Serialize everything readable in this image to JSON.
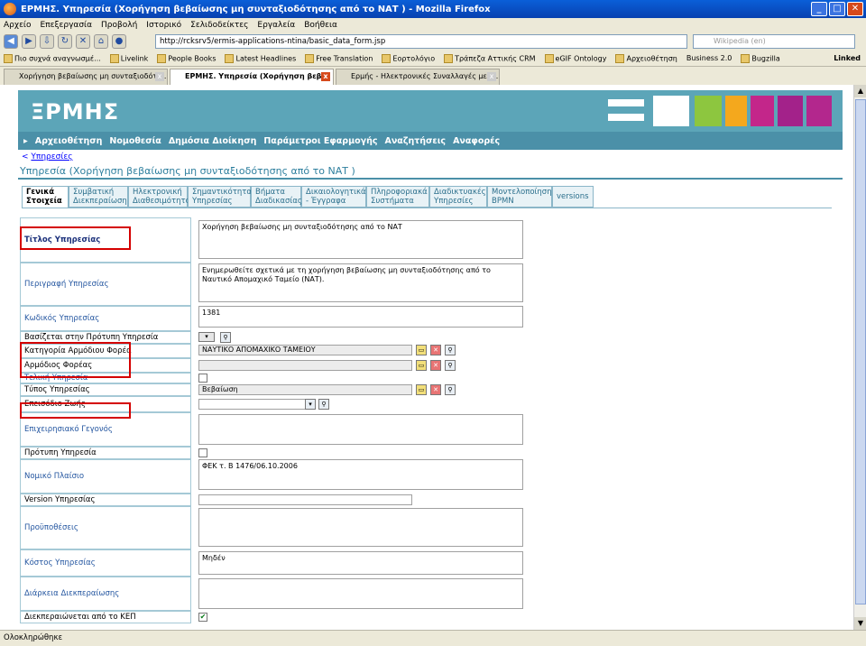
{
  "browser": {
    "title": "ΕΡΜΗΣ. Υπηρεσία (Χορήγηση βεβαίωσης μη συνταξιοδότησης από το ΝΑΤ ) - Mozilla Firefox",
    "menu": [
      "Αρχείο",
      "Επεξεργασία",
      "Προβολή",
      "Ιστορικό",
      "Σελιδοδείκτες",
      "Εργαλεία",
      "Βοήθεια"
    ],
    "url": "http://rcksrv5/ermis-applications-ntina/basic_data_form.jsp",
    "search_placeholder": "Wikipedia (en)",
    "bookmarks": [
      "Πιο συχνά αναγνωσμέ...",
      "Livelink",
      "People Books",
      "Latest Headlines",
      "Free Translation",
      "Εορτολόγιο",
      "Τράπεζα Αττικής CRM",
      "eGIF Ontology",
      "Αρχειοθέτηση",
      "Business 2.0",
      "Bugzilla",
      "Linked"
    ],
    "tabs": [
      "Χορήγηση βεβαίωσης μη συνταξιοδότη...",
      "ΕΡΜΗΣ. Υπηρεσία (Χορήγηση βεβ...",
      "Ερμής - Ηλεκτρονικές Συναλλαγές με τ..."
    ],
    "status": "Ολοκληρώθηκε"
  },
  "site": {
    "logo": "ΞΡΜΗΣ",
    "nav": [
      "Αρχειοθέτηση",
      "Νομοθεσία",
      "Δημόσια Διοίκηση",
      "Παράμετροι Εφαρμογής",
      "Αναζητήσεις",
      "Αναφορές"
    ],
    "back_prefix": "<",
    "back_link": "Υπηρεσίες",
    "page_title": "Υπηρεσία (Χορήγηση βεβαίωσης μη συνταξιοδότησης από το ΝΑΤ )",
    "tabs": [
      {
        "l1": "Γενικά",
        "l2": "Στοιχεία"
      },
      {
        "l1": "Συμβατική",
        "l2": "Διεκπεραίωση"
      },
      {
        "l1": "Ηλεκτρονική",
        "l2": "Διαθεσιμότητα"
      },
      {
        "l1": "Σημαντικότητα",
        "l2": "Υπηρεσίας"
      },
      {
        "l1": "Βήματα",
        "l2": "Διαδικασίας"
      },
      {
        "l1": "Δικαιολογητικά",
        "l2": "- Έγγραφα"
      },
      {
        "l1": "Πληροφοριακά",
        "l2": "Συστήματα"
      },
      {
        "l1": "Διαδικτυακές",
        "l2": "Υπηρεσίες"
      },
      {
        "l1": "Μοντελοποίηση",
        "l2": "BPMN"
      },
      {
        "l1": "versions",
        "l2": ""
      }
    ]
  },
  "form": {
    "title_label": "Τίτλος Υπηρεσίας",
    "title_value": "Χορήγηση βεβαίωσης μη συνταξιοδότησης από το ΝΑΤ",
    "desc_label": "Περιγραφή Υπηρεσίας",
    "desc_value": "Ενημερωθείτε σχετικά με τη χορήγηση βεβαίωσης μη συνταξιοδότησης από το Ναυτικό Απομαχικό Ταμείο (ΝΑΤ).",
    "code_label": "Κωδικός Υπηρεσίας",
    "code_value": "1381",
    "template_label": "Βασίζεται στην Πρότυπη Υπηρεσία",
    "cat_label": "Κατηγορία Αρμόδιου Φορέα",
    "cat_value": "ΝΑΥΤΙΚΟ ΑΠΟΜΑΧΙΚΟ ΤΑΜΕΙΟΥ",
    "agency_label": "Αρμόδιος Φορέας",
    "agency_value": "",
    "final_label": "Τελική Υπηρεσία",
    "type_label": "Τύπος Υπηρεσίας",
    "type_value": "Βεβαίωση",
    "life_label": "Επεισόδιο Ζωής",
    "biz_label": "Επιχειρησιακό Γεγονός",
    "proto_label": "Πρότυπη Υπηρεσία",
    "legal_label": "Νομικό Πλαίσιο",
    "legal_value": "ΦΕΚ τ. Β 1476/06.10.2006",
    "version_label": "Version Υπηρεσίας",
    "pre_label": "Προϋποθέσεις",
    "cost_label": "Κόστος Υπηρεσίας",
    "cost_value": "Μηδέν",
    "duration_label": "Διάρκεια Διεκπεραίωσης",
    "kep_label": "Διεκπεραιώνεται από το ΚΕΠ",
    "kep_checked": "✔"
  }
}
